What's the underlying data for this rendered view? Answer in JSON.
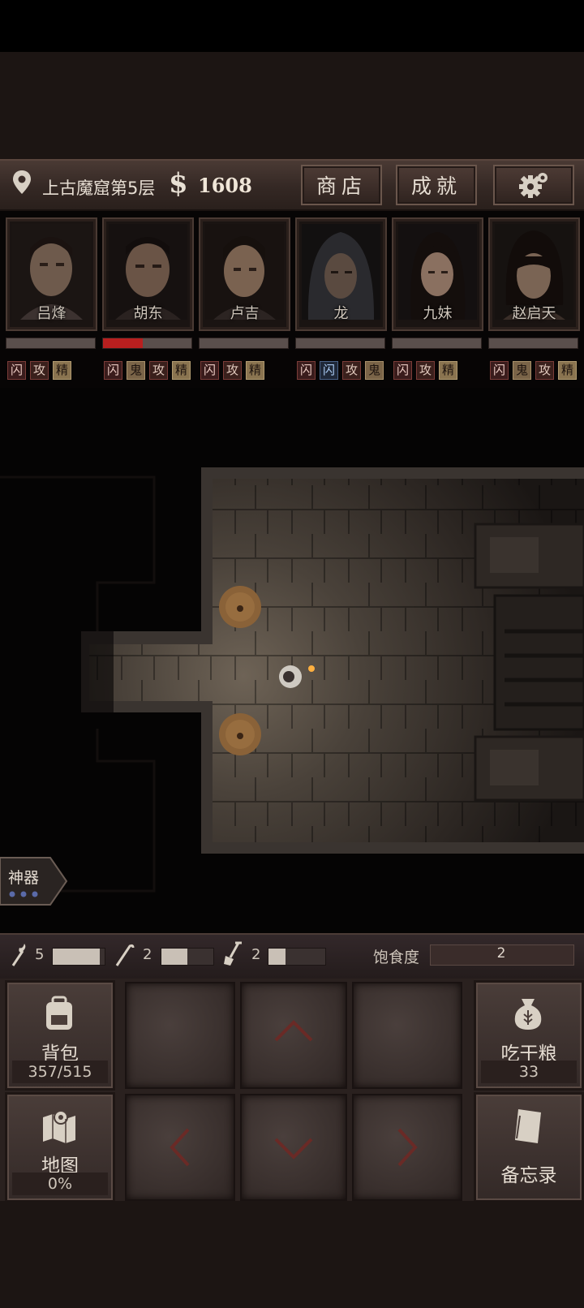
{
  "header": {
    "location": "上古魔窟第5层",
    "currency_symbol": "$",
    "gold": "1608",
    "shop_label": "商店",
    "achievements_label": "成就",
    "settings_icon": "gear-icon",
    "location_icon": "map-pin-icon"
  },
  "party": [
    {
      "name": "吕烽",
      "hp": 0.0,
      "tags": [
        "闪",
        "攻",
        "精"
      ]
    },
    {
      "name": "胡东",
      "hp": 0.45,
      "tags": [
        "闪",
        "鬼",
        "攻",
        "精"
      ]
    },
    {
      "name": "卢吉",
      "hp": 0.0,
      "tags": [
        "闪",
        "攻",
        "精"
      ]
    },
    {
      "name": "龙",
      "hp": 0.0,
      "tags": [
        "闪",
        "闪",
        "攻",
        "鬼"
      ]
    },
    {
      "name": "九妹",
      "hp": 0.0,
      "tags": [
        "闪",
        "攻",
        "精"
      ]
    },
    {
      "name": "赵启天",
      "hp": 0.0,
      "tags": [
        "闪",
        "鬼",
        "攻",
        "精"
      ]
    }
  ],
  "artifact": {
    "label": "神器"
  },
  "stats": {
    "torch": {
      "count": "5",
      "level": 0.9
    },
    "crowbar": {
      "count": "2",
      "level": 0.5
    },
    "shovel": {
      "count": "2",
      "level": 0.3
    },
    "hunger_label": "饱食度",
    "hunger_value": "2"
  },
  "controls": {
    "backpack_label": "背包",
    "backpack_count": "357/515",
    "eat_label": "吃干粮",
    "eat_count": "33",
    "map_label": "地图",
    "map_progress": "0%",
    "memo_label": "备忘录"
  },
  "colors": {
    "accent_red": "#b81f1f",
    "panel_bg": "#2a211f",
    "header_bg": "#342824"
  }
}
